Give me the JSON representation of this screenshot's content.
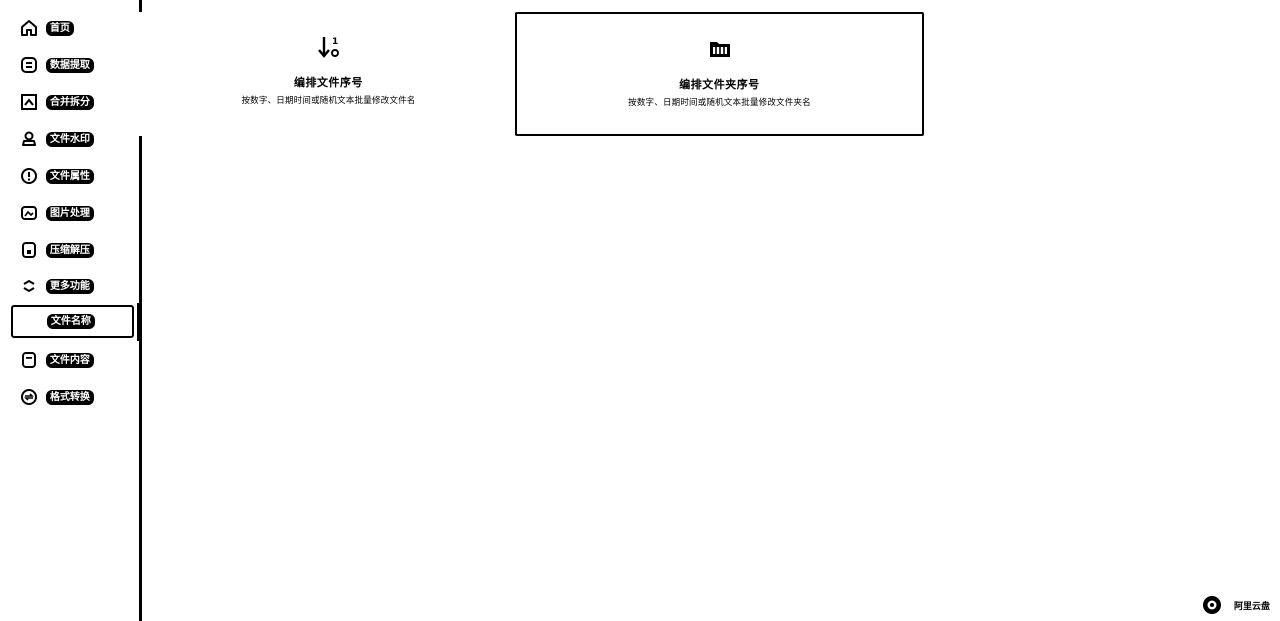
{
  "sidebar": {
    "items": [
      {
        "label": "首页",
        "icon": "home-icon"
      },
      {
        "label": "数据提取",
        "icon": "database-icon"
      },
      {
        "label": "合并拆分",
        "icon": "merge-split-icon"
      },
      {
        "label": "文件水印",
        "icon": "stamp-icon"
      },
      {
        "label": "文件属性",
        "icon": "info-icon"
      },
      {
        "label": "图片处理",
        "icon": "image-icon"
      },
      {
        "label": "压缩解压",
        "icon": "archive-icon"
      },
      {
        "label": "更多功能",
        "icon": "more-icon"
      },
      {
        "label": "文件名称",
        "icon": ""
      },
      {
        "label": "文件内容",
        "icon": "document-icon"
      },
      {
        "label": "格式转换",
        "icon": "convert-icon"
      }
    ],
    "active_label": "文件名称"
  },
  "cards": [
    {
      "title": "编排文件序号",
      "description": "按数字、日期时间或随机文本批量修改文件名",
      "icon": "sort-number-icon"
    },
    {
      "title": "编排文件夹序号",
      "description": "按数字、日期时间或随机文本批量修改文件夹名",
      "icon": "folder-number-icon"
    }
  ],
  "brand": {
    "text": "阿里云盘"
  }
}
